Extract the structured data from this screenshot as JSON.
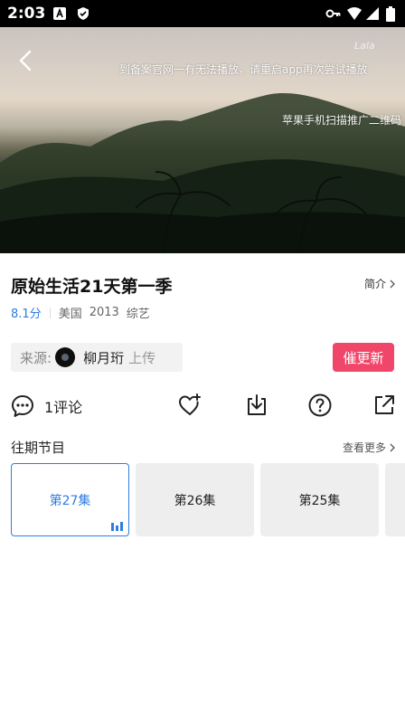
{
  "status_bar": {
    "time": "2:03",
    "icons": [
      "notification-a-icon",
      "shield-icon",
      "vpn-key-icon",
      "wifi-icon",
      "cellular-icon",
      "battery-icon"
    ]
  },
  "video": {
    "overlay_text_1": "到备案官网一有无法播放，请重启app再次尝试播放",
    "overlay_text_2": "苹果手机扫描推广二维码",
    "watermark": "Lala"
  },
  "show": {
    "title": "原始生活21天第一季",
    "intro_label": "简介",
    "score": "8.1分",
    "region": "美国",
    "year": "2013",
    "genre": "综艺"
  },
  "source": {
    "label": "来源:",
    "uploader": "柳月珩",
    "uploaded_label": "上传"
  },
  "urge_button": "催更新",
  "comments": {
    "count_label": "1评论"
  },
  "episodes": {
    "section_title": "往期节目",
    "more_label": "查看更多",
    "items": [
      {
        "label": "第27集",
        "active": true
      },
      {
        "label": "第26集",
        "active": false
      },
      {
        "label": "第25集",
        "active": false
      }
    ]
  },
  "colors": {
    "accent": "#2f7de1",
    "urge": "#f0466a"
  }
}
